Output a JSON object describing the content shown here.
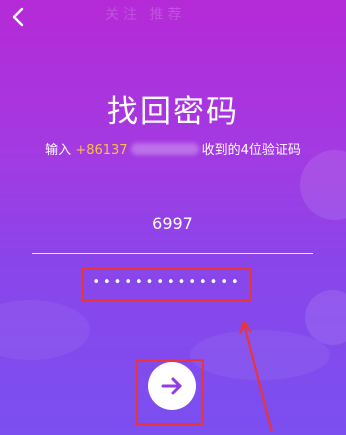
{
  "header": {
    "back_icon": "chevron-left-icon",
    "faded_text": "关注  推荐"
  },
  "title": "找回密码",
  "subtitle": {
    "prefix": "输入",
    "phone_prefix": "+86137",
    "suffix": "收到的4位验证码"
  },
  "form": {
    "code_value": "6997",
    "password_value": "••••••••••••••"
  },
  "submit": {
    "icon": "arrow-right-icon"
  },
  "colors": {
    "accent_phone": "#f6c242",
    "annotation": "#e8353a",
    "submit_arrow": "#8f3ee6"
  }
}
